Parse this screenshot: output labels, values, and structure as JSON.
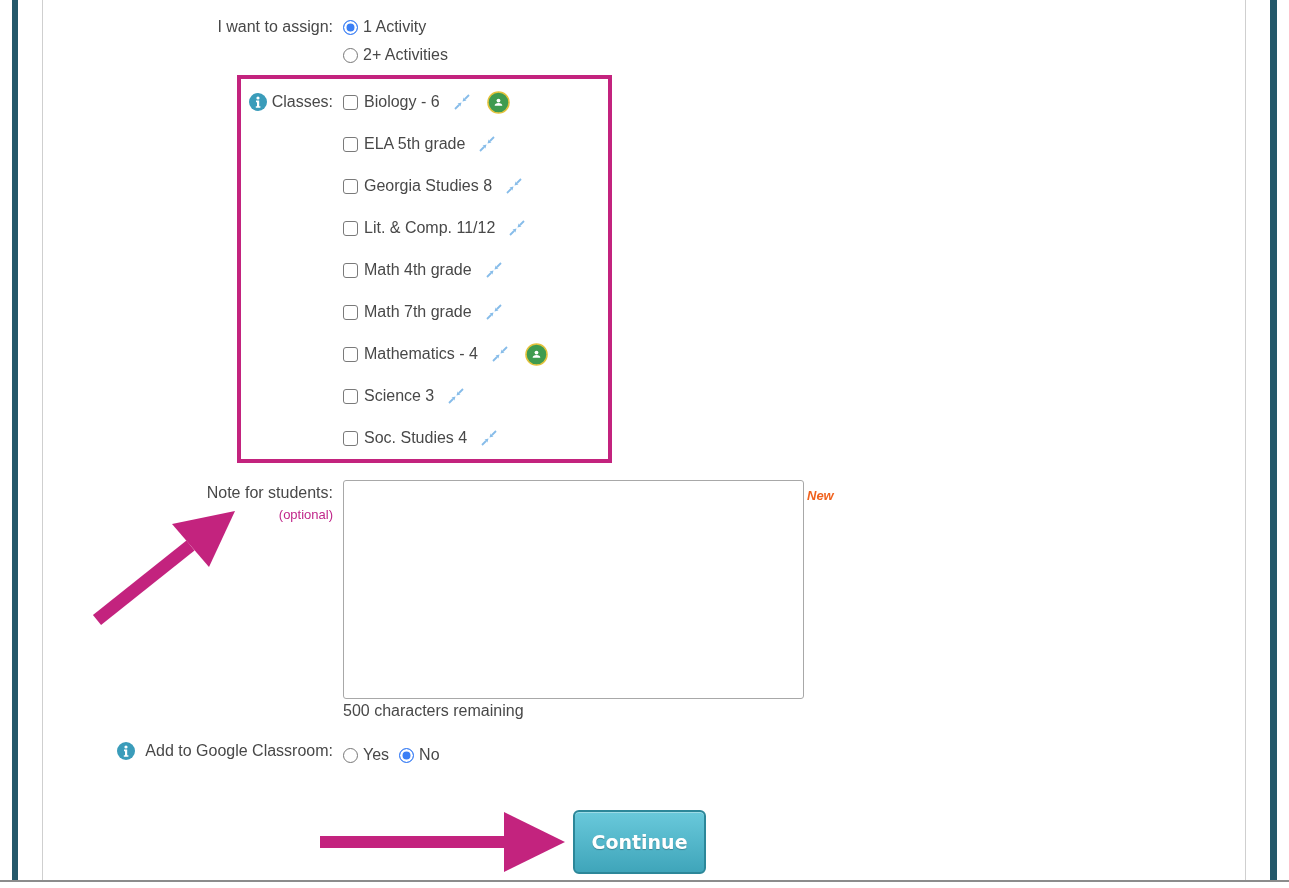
{
  "assign": {
    "label": "I want to assign:",
    "options": [
      {
        "label": "1 Activity",
        "selected": true
      },
      {
        "label": "2+ Activities",
        "selected": false
      }
    ]
  },
  "classes": {
    "label": "Classes:",
    "highlighted": true,
    "items": [
      {
        "name": "Biology - 6",
        "checked": false,
        "classroom": true
      },
      {
        "name": "ELA 5th grade",
        "checked": false,
        "classroom": false
      },
      {
        "name": "Georgia Studies 8",
        "checked": false,
        "classroom": false
      },
      {
        "name": "Lit. & Comp. 11/12",
        "checked": false,
        "classroom": false
      },
      {
        "name": "Math 4th grade",
        "checked": false,
        "classroom": false
      },
      {
        "name": "Math 7th grade",
        "checked": false,
        "classroom": false
      },
      {
        "name": "Mathematics - 4",
        "checked": false,
        "classroom": true
      },
      {
        "name": "Science 3",
        "checked": false,
        "classroom": false
      },
      {
        "name": "Soc. Studies 4",
        "checked": false,
        "classroom": false
      }
    ]
  },
  "note": {
    "label": "Note for students:",
    "hint": "(optional)",
    "badge": "New",
    "counter": "500 characters remaining",
    "arrow": true
  },
  "google_classroom": {
    "label": "Add to Google Classroom:",
    "options": [
      {
        "label": "Yes",
        "selected": false
      },
      {
        "label": "No",
        "selected": true
      }
    ]
  },
  "continue_button": {
    "label": "Continue",
    "arrow": true
  }
}
